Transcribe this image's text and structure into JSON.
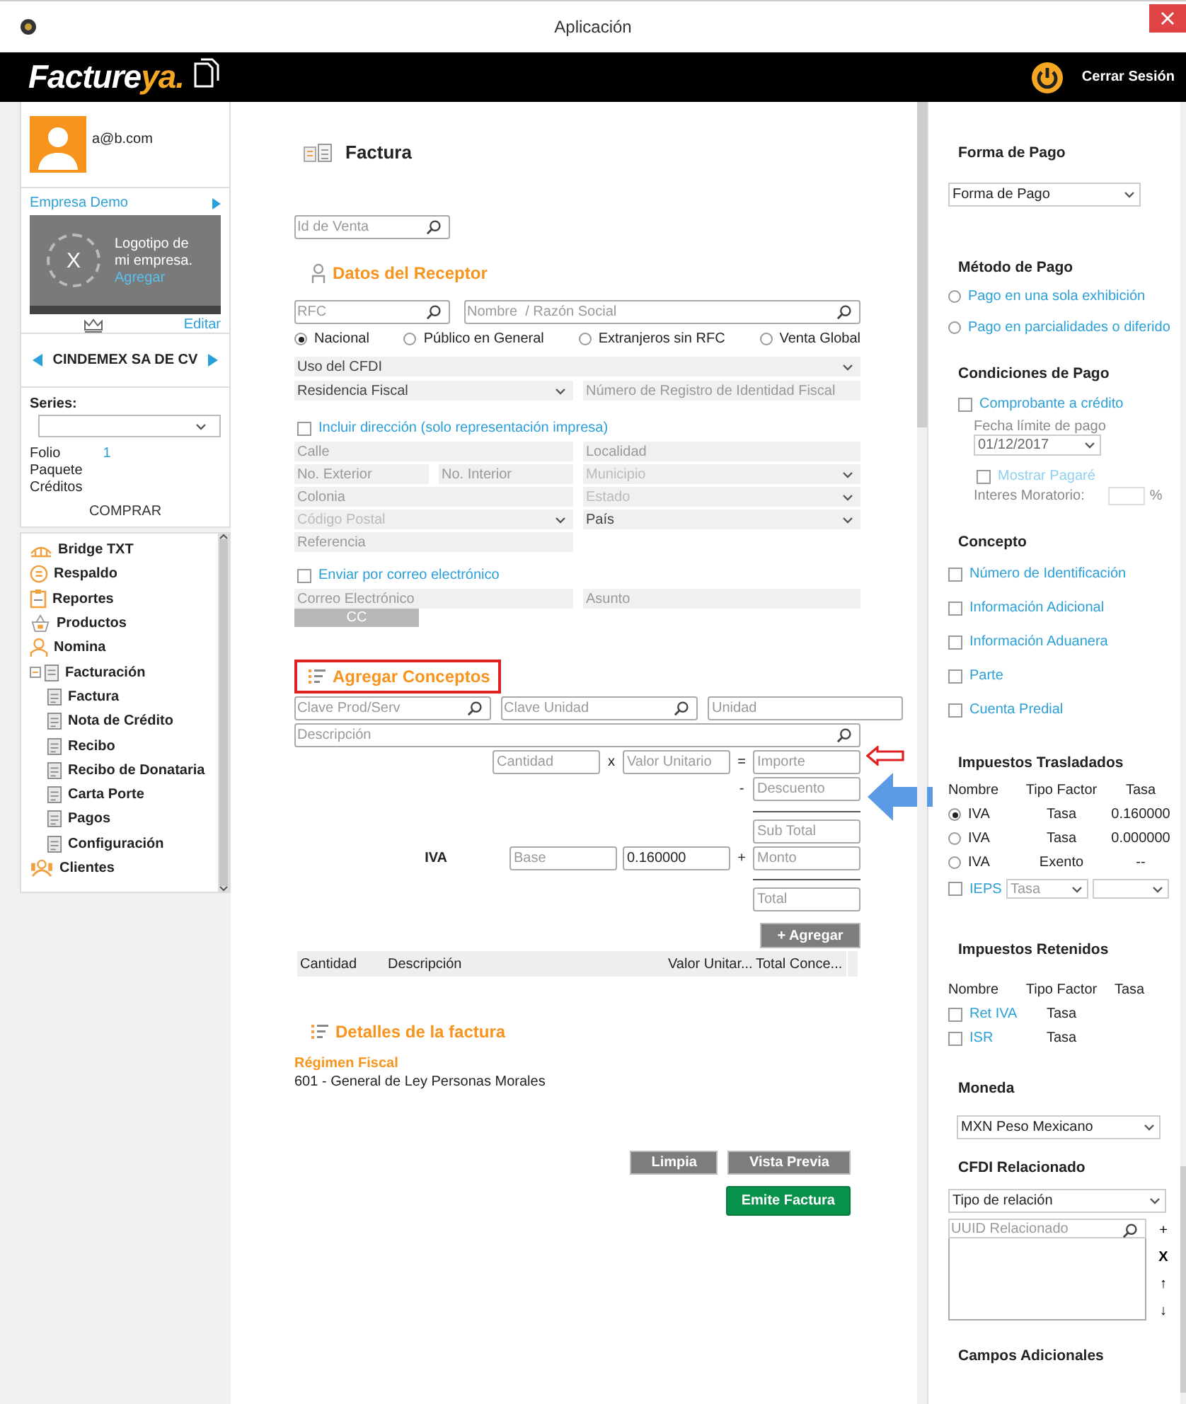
{
  "window": {
    "title": "Aplicación"
  },
  "header": {
    "logo_main": "Facture",
    "logo_accent": "ya.",
    "logout": "Cerrar Sesión"
  },
  "sidebar": {
    "email": "a@b.com",
    "company": "Empresa Demo",
    "logo_mark": "X",
    "logo_text": "Logotipo de mi empresa.",
    "logo_add": "Agregar",
    "edit": "Editar",
    "emisor": "CINDEMEX SA DE CV",
    "series_label": "Series:",
    "counters": [
      {
        "label": "Folio",
        "value": "1"
      },
      {
        "label": "Paquete"
      },
      {
        "label": "Créditos"
      }
    ],
    "buy": "COMPRAR",
    "nav": [
      {
        "label": "Bridge TXT"
      },
      {
        "label": "Respaldo"
      },
      {
        "label": "Reportes"
      },
      {
        "label": "Productos"
      },
      {
        "label": "Nomina"
      },
      {
        "label": "Facturación",
        "expanded": true,
        "children": [
          {
            "label": "Factura"
          },
          {
            "label": "Nota de Crédito"
          },
          {
            "label": "Recibo"
          },
          {
            "label": "Recibo de Donataria"
          },
          {
            "label": "Carta Porte"
          },
          {
            "label": "Pagos"
          },
          {
            "label": "Configuración"
          }
        ]
      },
      {
        "label": "Clientes"
      }
    ]
  },
  "main": {
    "title": "Factura",
    "sale_id": {
      "placeholder": "Id de Venta"
    },
    "receptor": {
      "title": "Datos del Receptor",
      "rfc": {
        "placeholder": "RFC"
      },
      "name": {
        "placeholder": "Nombre  / Razón Social"
      },
      "types": [
        {
          "label": "Nacional",
          "selected": true
        },
        {
          "label": "Público en General",
          "selected": false
        },
        {
          "label": "Extranjeros sin RFC",
          "selected": false
        },
        {
          "label": "Venta Global",
          "selected": false
        }
      ],
      "uso": "Uso del CFDI",
      "residencia": "Residencia Fiscal",
      "registro": {
        "placeholder": "Número de Registro de Identidad Fiscal"
      }
    },
    "address": {
      "label": "Incluir dirección (solo representación impresa)",
      "checked": false,
      "calle": {
        "placeholder": "Calle"
      },
      "localidad": {
        "placeholder": "Localidad"
      },
      "exterior": {
        "placeholder": "No. Exterior"
      },
      "interior": {
        "placeholder": "No. Interior"
      },
      "municipio": "Municipio",
      "colonia": {
        "placeholder": "Colonia"
      },
      "estado": "Estado",
      "cp": "Código Postal",
      "pais": "País",
      "referencia": {
        "placeholder": "Referencia"
      }
    },
    "email": {
      "label": "Enviar por correo electrónico",
      "checked": false,
      "correo": {
        "placeholder": "Correo Electrónico"
      },
      "asunto": {
        "placeholder": "Asunto"
      },
      "cc": "CC"
    },
    "conceptos": {
      "title": "Agregar Conceptos",
      "clave_prod": {
        "placeholder": "Clave Prod/Serv"
      },
      "clave_unidad": {
        "placeholder": "Clave Unidad"
      },
      "unidad": {
        "placeholder": "Unidad"
      },
      "descripcion": {
        "placeholder": "Descripción"
      },
      "cantidad": {
        "placeholder": "Cantidad"
      },
      "times": "x",
      "valor": {
        "placeholder": "Valor Unitario"
      },
      "equals": "=",
      "importe": {
        "placeholder": "Importe"
      },
      "minus": "-",
      "descuento": {
        "placeholder": "Descuento"
      },
      "subtotal": {
        "placeholder": "Sub Total"
      },
      "tax": "IVA",
      "base": {
        "placeholder": "Base"
      },
      "rate": "0.160000",
      "plus": "+",
      "monto": {
        "placeholder": "Monto"
      },
      "total": {
        "placeholder": "Total"
      },
      "add": "+ Agregar",
      "columns": [
        "Cantidad",
        "Descripción",
        "Valor Unitar...",
        "Total Conce..."
      ]
    },
    "details": {
      "title": "Detalles de la factura",
      "regimen_label": "Régimen Fiscal",
      "regimen": "601 - General de Ley Personas Morales"
    },
    "actions": {
      "clear": "Limpia",
      "preview": "Vista Previa",
      "emit": "Emite Factura"
    }
  },
  "panel": {
    "forma": {
      "title": "Forma de Pago",
      "select": "Forma de Pago"
    },
    "metodo": {
      "title": "Método de Pago",
      "options": [
        {
          "label": "Pago en una sola exhibición",
          "selected": false
        },
        {
          "label": "Pago en parcialidades o diferido",
          "selected": false
        }
      ]
    },
    "condiciones": {
      "title": "Condiciones de Pago",
      "credit": {
        "label": "Comprobante a crédito",
        "checked": false
      },
      "due_label": "Fecha límite de pago",
      "due": "01/12/2017",
      "pagare": {
        "label": "Mostrar Pagaré",
        "checked": false
      },
      "interest_label": "Interes Moratorio:",
      "percent": "%"
    },
    "concepto": {
      "title": "Concepto",
      "options": [
        {
          "label": "Número de Identificación",
          "checked": false
        },
        {
          "label": "Información Adicional",
          "checked": false
        },
        {
          "label": "Información Aduanera",
          "checked": false
        },
        {
          "label": "Parte",
          "checked": false
        },
        {
          "label": "Cuenta Predial",
          "checked": false
        }
      ]
    },
    "traslados": {
      "title": "Impuestos Trasladados",
      "columns": [
        "Nombre",
        "Tipo Factor",
        "Tasa"
      ],
      "rows": [
        {
          "name": "IVA",
          "factor": "Tasa",
          "rate": "0.160000",
          "selected": true
        },
        {
          "name": "IVA",
          "factor": "Tasa",
          "rate": "0.000000",
          "selected": false
        },
        {
          "name": "IVA",
          "factor": "Exento",
          "rate": "--",
          "selected": false
        }
      ],
      "ieps": {
        "label": "IEPS",
        "checked": false,
        "factor": "Tasa"
      }
    },
    "retenidos": {
      "title": "Impuestos Retenidos",
      "columns": [
        "Nombre",
        "Tipo Factor",
        "Tasa"
      ],
      "rows": [
        {
          "label": "Ret IVA",
          "factor": "Tasa",
          "checked": false
        },
        {
          "label": "ISR",
          "factor": "Tasa",
          "checked": false
        }
      ]
    },
    "moneda": {
      "title": "Moneda",
      "select": "MXN Peso Mexicano"
    },
    "cfdi": {
      "title": "CFDI Relacionado",
      "select": "Tipo de relación",
      "uuid": {
        "placeholder": "UUID Relacionado"
      },
      "add": "+",
      "remove": "X",
      "up": "↑",
      "down": "↓"
    },
    "extra": {
      "title": "Campos Adicionales"
    }
  }
}
